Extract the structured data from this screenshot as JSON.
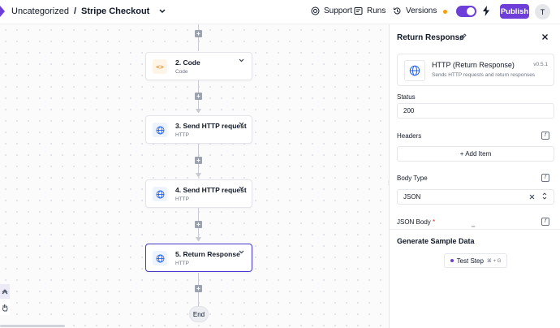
{
  "header": {
    "folder": "Uncategorized",
    "separator": "/",
    "flow_name": "Stripe Checkout",
    "support_label": "Support",
    "runs_label": "Runs",
    "versions_label": "Versions",
    "publish_label": "Publish",
    "avatar_initial": "T",
    "accent_color": "#6d3fd8"
  },
  "canvas": {
    "steps": [
      {
        "title": "2. Code",
        "subtitle": "Code",
        "icon": "code-icon"
      },
      {
        "title": "3. Send HTTP request",
        "subtitle": "HTTP",
        "icon": "globe-icon"
      },
      {
        "title": "4. Send HTTP request",
        "subtitle": "HTTP",
        "icon": "globe-icon"
      },
      {
        "title": "5. Return Response",
        "subtitle": "HTTP",
        "icon": "globe-icon"
      }
    ],
    "end_label": "End"
  },
  "panel": {
    "title": "Return Response",
    "piece_name": "HTTP (Return Response)",
    "piece_version": "v0.5.1",
    "piece_description": "Sends HTTP requests and return responses",
    "status_label": "Status",
    "status_value": "200",
    "headers_label": "Headers",
    "add_item_label": "+ Add Item",
    "body_type_label": "Body Type",
    "body_type_value": "JSON",
    "json_body_label": "JSON Body",
    "required_mark": "*",
    "generate_title": "Generate Sample Data",
    "test_step_label": "Test Step",
    "test_step_shortcut": "⌘ + G"
  }
}
